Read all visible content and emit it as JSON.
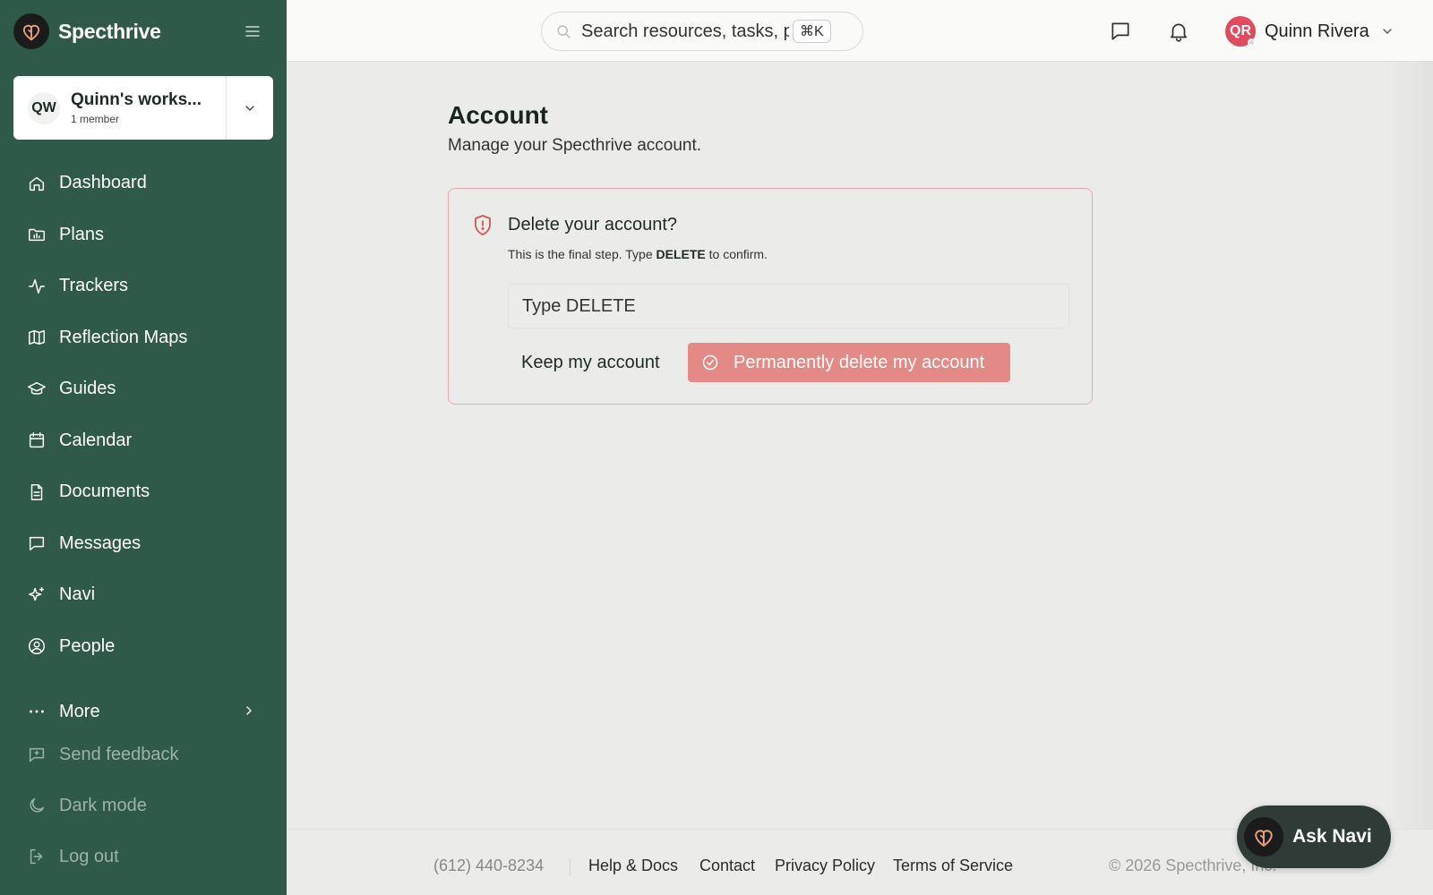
{
  "app": {
    "name": "Specthrive"
  },
  "sidebar": {
    "workspace": {
      "initials": "QW",
      "name": "Quinn's works...",
      "members": "1 member"
    },
    "items": [
      {
        "label": "Dashboard",
        "icon": "home-icon"
      },
      {
        "label": "Plans",
        "icon": "folder-chart-icon"
      },
      {
        "label": "Trackers",
        "icon": "activity-icon"
      },
      {
        "label": "Reflection Maps",
        "icon": "map-icon"
      },
      {
        "label": "Guides",
        "icon": "graduation-cap-icon"
      },
      {
        "label": "Calendar",
        "icon": "calendar-icon"
      },
      {
        "label": "Documents",
        "icon": "document-icon"
      },
      {
        "label": "Messages",
        "icon": "message-icon"
      },
      {
        "label": "Navi",
        "icon": "sparkles-icon"
      },
      {
        "label": "People",
        "icon": "user-circle-icon"
      }
    ],
    "more": "More",
    "send_feedback": "Send feedback",
    "dark_mode": "Dark mode",
    "log_out": "Log out"
  },
  "topbar": {
    "search_placeholder": "Search resources, tasks, p",
    "shortcut": "⌘K",
    "user": {
      "initials": "QR",
      "name": "Quinn Rivera"
    }
  },
  "page": {
    "title": "Account",
    "subtitle": "Manage your Specthrive account."
  },
  "danger": {
    "title": "Delete your account?",
    "desc_prefix": "This is the final step. Type ",
    "desc_keyword": "DELETE",
    "desc_suffix": " to confirm.",
    "input_placeholder": "Type DELETE",
    "keep_label": "Keep my account",
    "delete_label": "Permanently delete my account"
  },
  "footer": {
    "phone": "(612) 440-8234",
    "links": [
      "Help & Docs",
      "Contact",
      "Privacy Policy",
      "Terms of Service"
    ],
    "copyright": "© 2026 Specthrive, Inc."
  },
  "ask_navi": "Ask Navi",
  "colors": {
    "sidebar": "#2f5a4a",
    "danger_button": "#e38a86",
    "avatar": "#e04b5e",
    "danger_border": "#e8a8a8"
  }
}
